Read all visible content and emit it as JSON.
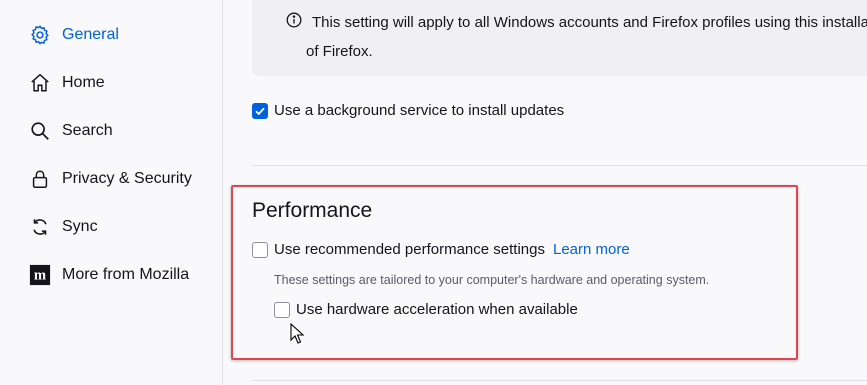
{
  "sidebar": {
    "items": [
      {
        "label": "General",
        "icon": "gear-icon",
        "active": true
      },
      {
        "label": "Home",
        "icon": "home-icon",
        "active": false
      },
      {
        "label": "Search",
        "icon": "search-icon",
        "active": false
      },
      {
        "label": "Privacy & Security",
        "icon": "lock-icon",
        "active": false
      },
      {
        "label": "Sync",
        "icon": "sync-icon",
        "active": false
      },
      {
        "label": "More from Mozilla",
        "icon": "mozilla-logo-icon",
        "active": false
      }
    ]
  },
  "notice": {
    "line1": "This setting will apply to all Windows accounts and Firefox profiles using this installat",
    "line2": "of Firefox."
  },
  "updates": {
    "background_service_label": "Use a background service to install updates",
    "background_service_checked": true
  },
  "performance": {
    "title": "Performance",
    "recommended_label": "Use recommended performance settings",
    "recommended_checked": false,
    "learn_more": "Learn more",
    "hint": "These settings are tailored to your computer's hardware and operating system.",
    "hw_accel_label": "Use hardware acceleration when available",
    "hw_accel_checked": false
  },
  "colors": {
    "accent": "#0061e0",
    "highlight_border": "#e0464f"
  }
}
